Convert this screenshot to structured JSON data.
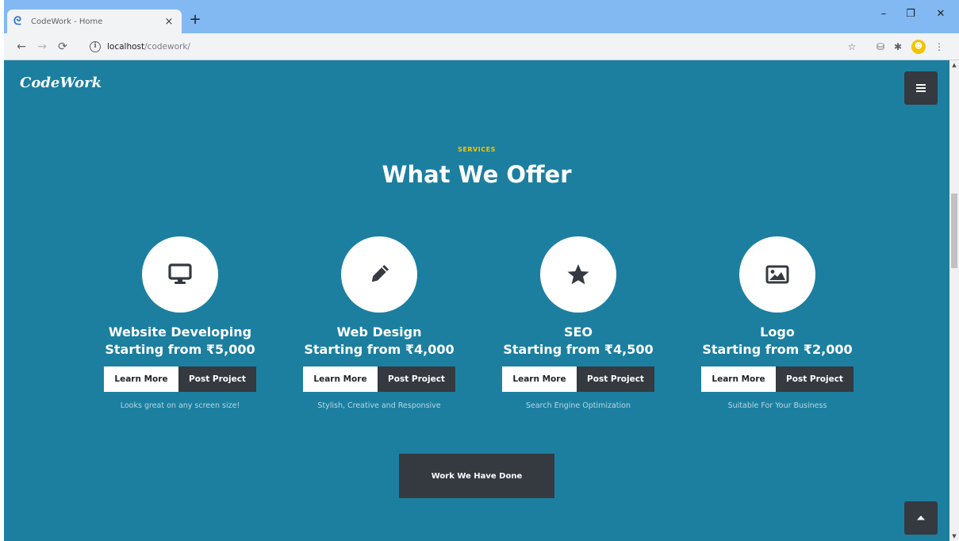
{
  "browser": {
    "tab_title": "CodeWork - Home",
    "tab_close": "×",
    "new_tab": "+",
    "url_host": "localhost",
    "url_path": "/codework/",
    "window_controls": {
      "minimize": "–",
      "restore": "❐",
      "close": "✕"
    }
  },
  "page": {
    "brand": "CodeWork",
    "section_label": "SERVICES",
    "section_title": "What We Offer",
    "accent_color": "#f6c400",
    "background_color": "#1c7fa0",
    "dark_button_color": "#343a40",
    "services": [
      {
        "icon": "monitor-icon",
        "name": "Website Developing",
        "price": "Starting from ₹5,000",
        "learn": "Learn More",
        "post": "Post Project",
        "desc": "Looks great on any screen size!"
      },
      {
        "icon": "pencil-icon",
        "name": "Web Design",
        "price": "Starting from ₹4,000",
        "learn": "Learn More",
        "post": "Post Project",
        "desc": "Stylish, Creative and Responsive"
      },
      {
        "icon": "star-icon",
        "name": "SEO",
        "price": "Starting from ₹4,500",
        "learn": "Learn More",
        "post": "Post Project",
        "desc": "Search Engine Optimization"
      },
      {
        "icon": "image-icon",
        "name": "Logo",
        "price": "Starting from ₹2,000",
        "learn": "Learn More",
        "post": "Post Project",
        "desc": "Suitable For Your Business"
      }
    ],
    "work_button": "Work We Have Done"
  }
}
